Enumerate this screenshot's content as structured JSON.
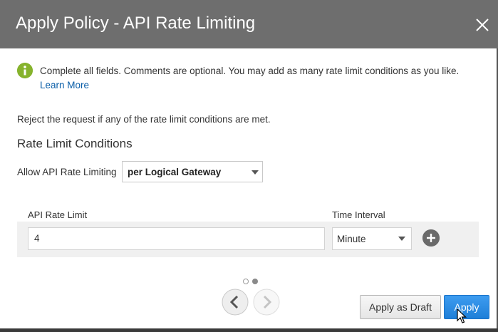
{
  "dialog": {
    "title": "Apply Policy - API Rate Limiting",
    "close_icon": "close-icon"
  },
  "info": {
    "icon": "info-icon",
    "message": "Complete all fields. Comments are optional. You may add as many rate limit conditions as you like.",
    "learn_more": "Learn More",
    "accent": "#86b32d"
  },
  "policy": {
    "reject_text": "Reject the request if any of the rate limit conditions are met.",
    "section_title": "Rate Limit Conditions",
    "allow_label": "Allow API Rate Limiting",
    "scope_value": "per Logical Gateway"
  },
  "condition": {
    "rate_limit_label": "API Rate Limit",
    "time_interval_label": "Time Interval",
    "rate_limit_value": "4",
    "time_interval_value": "Minute",
    "add_icon": "plus-circle-icon"
  },
  "pagination": {
    "current_page": 2,
    "total_pages": 2,
    "prev_icon": "chevron-left-icon",
    "next_icon": "chevron-right-icon"
  },
  "footer": {
    "apply_draft_label": "Apply as Draft",
    "apply_label": "Apply",
    "apply_color": "#2a8ae0"
  }
}
